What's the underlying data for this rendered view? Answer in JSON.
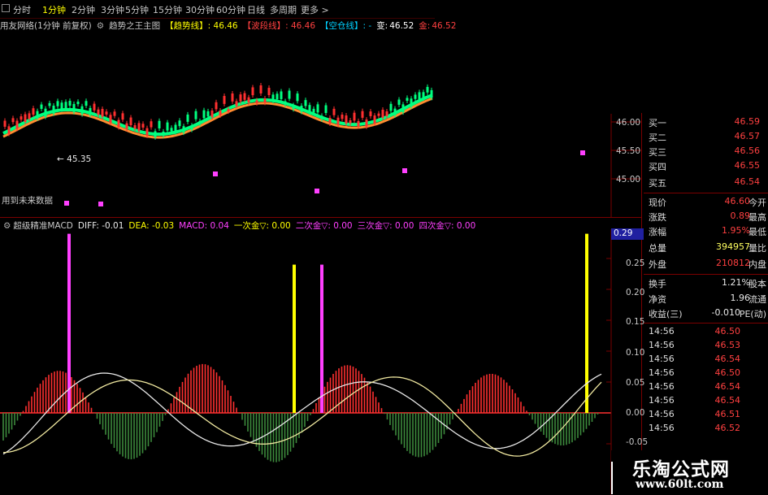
{
  "colors": {
    "up": "#ff3030",
    "down": "#00ff7f",
    "yellow": "#ffff00",
    "magenta": "#ff40ff",
    "white": "#e8e8e8",
    "orange": "#ff8c30",
    "label": "#c8c8c8"
  },
  "topbar": {
    "tabs": [
      "分时",
      "1分钟",
      "2分钟",
      "3分钟",
      "5分钟",
      "15分钟",
      "30分钟",
      "60分钟",
      "日线",
      "多周期",
      "更多 >"
    ],
    "active": "1分钟"
  },
  "main": {
    "title": "用友网络(1分钟 前复权)",
    "indicator": "趋势之王主图",
    "trend_label": "【趋势线】",
    "trend_value": ": 46.46",
    "wave_label": "【波段线】",
    "wave_value": ": 46.46",
    "empty_label": "【空仓线】",
    "empty_value": ": -",
    "change_label": "变:",
    "change_value": "46.52",
    "gold_label": "金:",
    "gold_value": "46.52",
    "low_marker": "← 45.35",
    "future_label": "用到未来数据",
    "price_axis": [
      "46.00",
      "45.50",
      "45.00"
    ]
  },
  "macd": {
    "title": "超级精准MACD",
    "diff": "DIFF: -0.01",
    "dea": "DEA: -0.03",
    "macd": "MACD: 0.04",
    "s1": "一次金▽: 0.00",
    "s2": "二次金▽: 0.00",
    "s3": "三次金▽: 0.00",
    "s4": "四次金▽: 0.00",
    "axis": [
      "0.25",
      "0.20",
      "0.15",
      "0.10",
      "0.05",
      "0.00",
      "-0.05"
    ],
    "current": "0.29"
  },
  "panel": {
    "bids": [
      {
        "k": "买一",
        "v": "46.59"
      },
      {
        "k": "买二",
        "v": "46.57"
      },
      {
        "k": "买三",
        "v": "46.56"
      },
      {
        "k": "买四",
        "v": "46.55"
      },
      {
        "k": "买五",
        "v": "46.54"
      }
    ],
    "quote": [
      {
        "k": "现价",
        "v": "46.60",
        "s": "今开"
      },
      {
        "k": "涨跌",
        "v": "0.89",
        "s": "最高"
      },
      {
        "k": "涨幅",
        "v": "1.95%",
        "s": "最低"
      },
      {
        "k": "总量",
        "v": "394957",
        "s": "量比"
      },
      {
        "k": "外盘",
        "v": "210812",
        "s": "内盘"
      }
    ],
    "fund": [
      {
        "k": "换手",
        "v": "1.21%",
        "s": "股本"
      },
      {
        "k": "净资",
        "v": "1.96",
        "s": "流通"
      },
      {
        "k": "收益(三)",
        "v": "-0.010",
        "s": "PE(动)"
      }
    ],
    "ticks": [
      {
        "t": "14:56",
        "p": "46.50"
      },
      {
        "t": "14:56",
        "p": "46.53"
      },
      {
        "t": "14:56",
        "p": "46.54"
      },
      {
        "t": "14:56",
        "p": "46.50"
      },
      {
        "t": "14:56",
        "p": "46.54"
      },
      {
        "t": "14:56",
        "p": "46.54"
      },
      {
        "t": "14:56",
        "p": "46.51"
      },
      {
        "t": "14:56",
        "p": "46.52"
      }
    ]
  },
  "watermark": {
    "cn": "乐淘公式网",
    "url": "www.60lt.com"
  }
}
